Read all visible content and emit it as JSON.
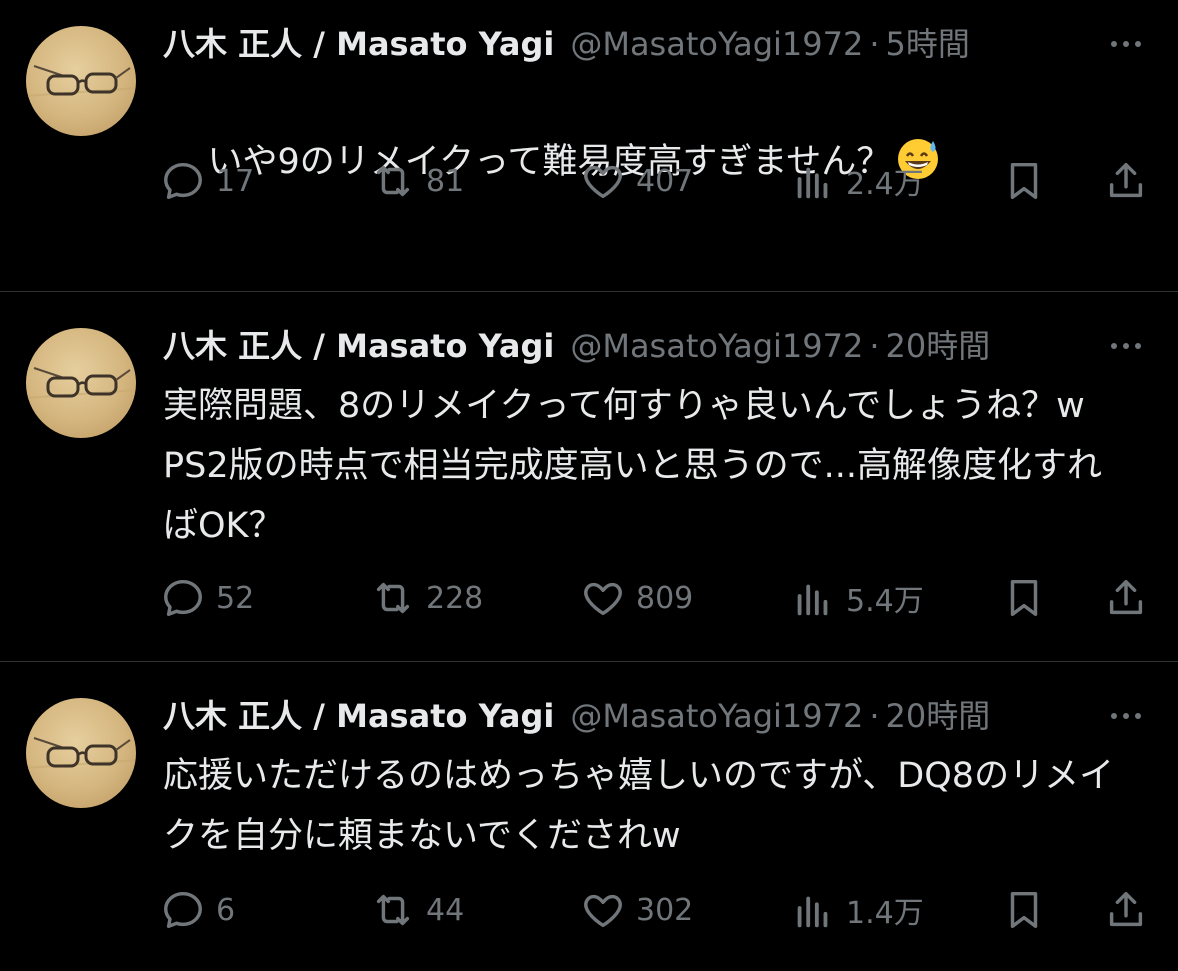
{
  "colors": {
    "background": "#000000",
    "text": "#e7e9ea",
    "muted": "#71767b",
    "divider": "#2f3336"
  },
  "tweets": [
    {
      "name": "八木 正人 / Masato Yagi",
      "handle": "@MasatoYagi1972",
      "separator": "·",
      "time": "5時間",
      "text": "いや9のリメイクって難易度高すぎません？",
      "emoji": "grinning-face-with-sweat",
      "replies": "17",
      "retweets": "81",
      "likes": "407",
      "views": "2.4万"
    },
    {
      "name": "八木 正人 / Masato Yagi",
      "handle": "@MasatoYagi1972",
      "separator": "·",
      "time": "20時間",
      "text": "実際問題、8のリメイクって何すりゃ良いんでしょうね？w　PS2版の時点で相当完成度高いと思うので...高解像度化すればOK？",
      "replies": "52",
      "retweets": "228",
      "likes": "809",
      "views": "5.4万"
    },
    {
      "name": "八木 正人 / Masato Yagi",
      "handle": "@MasatoYagi1972",
      "separator": "·",
      "time": "20時間",
      "text": "応援いただけるのはめっちゃ嬉しいのですが、DQ8のリメイクを自分に頼まないでくだされw",
      "replies": "6",
      "retweets": "44",
      "likes": "302",
      "views": "1.4万"
    }
  ]
}
